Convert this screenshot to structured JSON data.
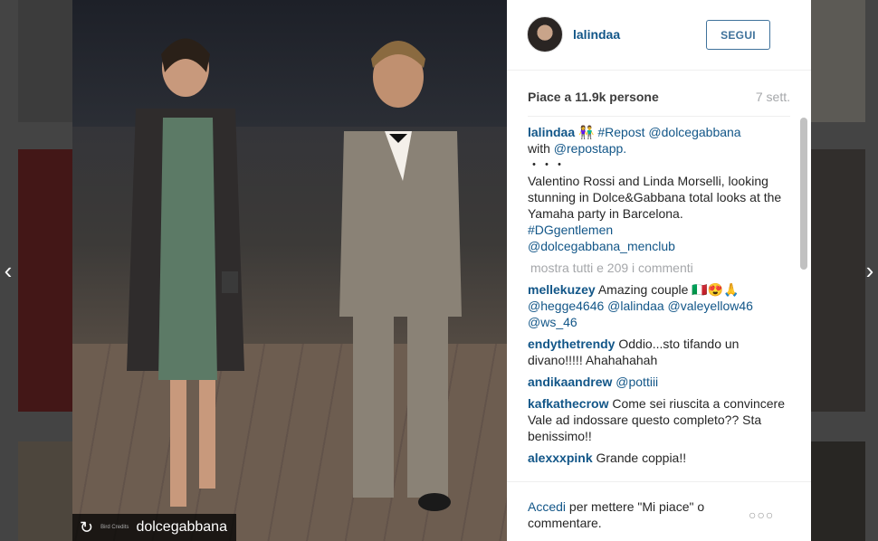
{
  "post": {
    "username": "lalindaa",
    "follow_label": "SEGUI",
    "likes": "Piace a 11.9k persone",
    "time": "7 sett."
  },
  "caption": {
    "user": "lalindaa",
    "emoji": "👫",
    "repost_tag": "#Repost",
    "repost_user": "@dolcegabbana",
    "with_text": "with",
    "app_tag": "@repostapp.",
    "dots": "・・・",
    "body": "Valentino Rossi and Linda Morselli, looking stunning in Dolce&Gabbana total looks at the Yamaha party in Barcelona.",
    "hashtag": "#DGgentlemen",
    "menclub": "@dolcegabbana_menclub"
  },
  "show_all": "mostra tutti e 209 i commenti",
  "comments": [
    {
      "user": "mellekuzey",
      "text": "Amazing couple 🇮🇹😍🙏",
      "mentions": "@hegge4646 @lalindaa @valeyellow46 @ws_46"
    },
    {
      "user": "endythetrendy",
      "text": "Oddio...sto tifando un divano!!!!! Ahahahahah"
    },
    {
      "user": "andikaandrew",
      "text": "",
      "mentions": "@pottiii"
    },
    {
      "user": "kafkathecrow",
      "text": "Come sei riuscita a convincere Vale ad indossare questo completo?? Sta benissimo!!"
    },
    {
      "user": "alexxxpink",
      "text": "Grande coppia!!"
    }
  ],
  "footer": {
    "login_link": "Accedi",
    "login_text": "per mettere \"Mi piace\" o commentare.",
    "options": "○○○"
  },
  "repost_badge": {
    "icon": "↻",
    "small_text": "Bird Credits",
    "name": "dolcegabbana"
  },
  "nav": {
    "prev": "‹",
    "next": "›"
  },
  "colors": {
    "link": "#125688",
    "follow": "#3f729b",
    "muted": "#a5a7aa"
  }
}
